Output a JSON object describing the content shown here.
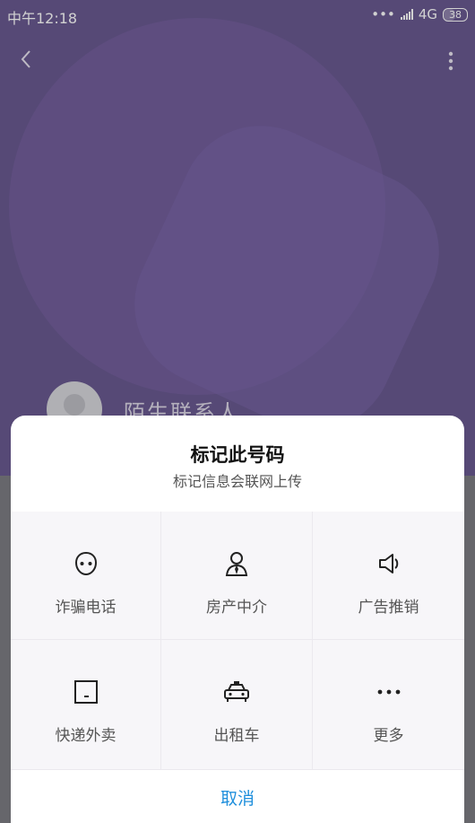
{
  "status_bar": {
    "time": "中午12:18",
    "network": "4G",
    "battery": "38"
  },
  "contact": {
    "name": "陌生联系人"
  },
  "sheet": {
    "title": "标记此号码",
    "subtitle": "标记信息会联网上传",
    "options": [
      {
        "label": "诈骗电话",
        "icon": "fraud-mask-icon"
      },
      {
        "label": "房产中介",
        "icon": "agent-person-icon"
      },
      {
        "label": "广告推销",
        "icon": "megaphone-icon"
      },
      {
        "label": "快递外卖",
        "icon": "package-box-icon"
      },
      {
        "label": "出租车",
        "icon": "taxi-icon"
      },
      {
        "label": "更多",
        "icon": "more-dots-icon"
      }
    ],
    "cancel_label": "取消"
  },
  "colors": {
    "header_purple": "#6a5a91",
    "accent_blue": "#1f8fdc"
  }
}
